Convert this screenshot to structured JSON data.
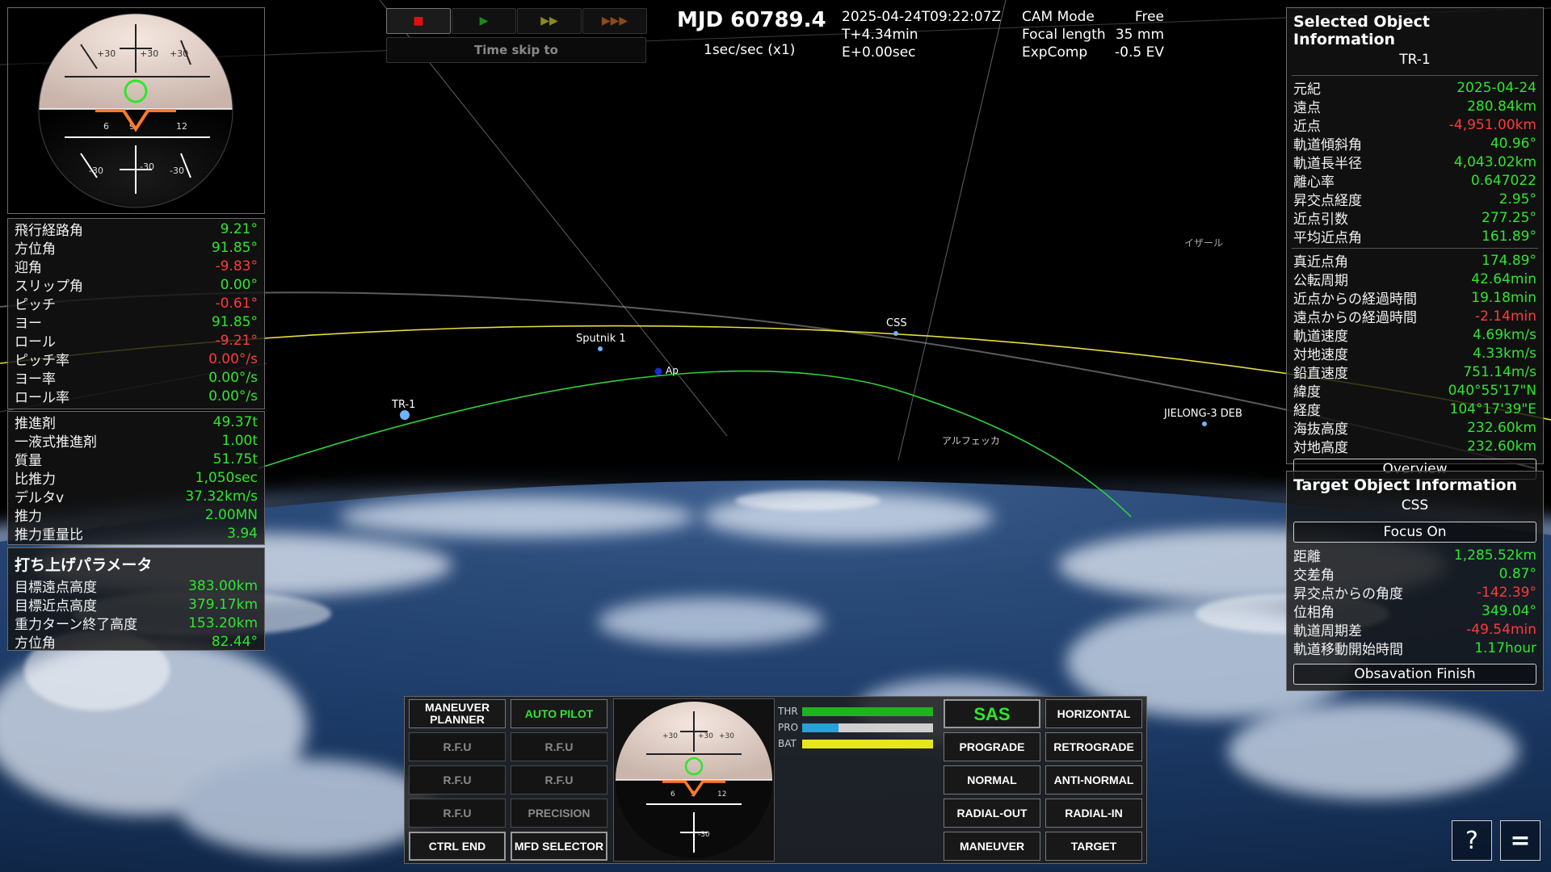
{
  "header": {
    "mjd": "MJD 60789.4",
    "rate": "1sec/sec (x1)",
    "utc": "2025-04-24T09:22:07Z",
    "t_plus": "T+4.34min",
    "e_plus": "E+0.00sec",
    "time_skip_label": "Time skip to",
    "cam_mode_label": "CAM Mode",
    "cam_mode_value": "Free",
    "focal_label": "Focal length",
    "focal_value": "35 mm",
    "exp_label": "ExpComp",
    "exp_value": "-0.5 EV"
  },
  "time_controls": [
    {
      "glyph": "■",
      "color": "#e01010",
      "active": true
    },
    {
      "glyph": "▶",
      "color": "#1c8a1c",
      "active": false
    },
    {
      "glyph": "▶▶",
      "color": "#8a8a1c",
      "active": false
    },
    {
      "glyph": "▶▶▶",
      "color": "#8a4a1c",
      "active": false
    }
  ],
  "flight": [
    {
      "k": "飛行経路角",
      "v": "9.21°",
      "s": "g"
    },
    {
      "k": "方位角",
      "v": "91.85°",
      "s": "g"
    },
    {
      "k": "迎角",
      "v": "-9.83°",
      "s": "r"
    },
    {
      "k": "スリップ角",
      "v": "0.00°",
      "s": "g"
    },
    {
      "k": "ピッチ",
      "v": "-0.61°",
      "s": "r"
    },
    {
      "k": "ヨー",
      "v": "91.85°",
      "s": "g"
    },
    {
      "k": "ロール",
      "v": "-9.21°",
      "s": "r"
    },
    {
      "k": "ピッチ率",
      "v": "0.00°/s",
      "s": "r"
    },
    {
      "k": "ヨー率",
      "v": "0.00°/s",
      "s": "g"
    },
    {
      "k": "ロール率",
      "v": "0.00°/s",
      "s": "g"
    }
  ],
  "propulsion": [
    {
      "k": "推進剤",
      "v": "49.37t",
      "s": "g"
    },
    {
      "k": "一液式推進剤",
      "v": "1.00t",
      "s": "g"
    },
    {
      "k": "質量",
      "v": "51.75t",
      "s": "g"
    },
    {
      "k": "比推力",
      "v": "1,050sec",
      "s": "g"
    },
    {
      "k": "デルタv",
      "v": "37.32km/s",
      "s": "g"
    },
    {
      "k": "推力",
      "v": "2.00MN",
      "s": "g"
    },
    {
      "k": "推力重量比",
      "v": "3.94",
      "s": "g"
    }
  ],
  "launch": {
    "title": "打ち上げパラメータ",
    "rows": [
      {
        "k": "目標遠点高度",
        "v": "383.00km",
        "s": "g"
      },
      {
        "k": "目標近点高度",
        "v": "379.17km",
        "s": "g"
      },
      {
        "k": "重力ターン終了高度",
        "v": "153.20km",
        "s": "g"
      },
      {
        "k": "方位角",
        "v": "82.44°",
        "s": "g"
      }
    ]
  },
  "selected": {
    "title": "Selected Object Information",
    "name": "TR-1",
    "rows1": [
      {
        "k": "元紀",
        "v": "2025-04-24",
        "s": "g"
      },
      {
        "k": "遠点",
        "v": "280.84km",
        "s": "g"
      },
      {
        "k": "近点",
        "v": "-4,951.00km",
        "s": "r"
      },
      {
        "k": "軌道傾斜角",
        "v": "40.96°",
        "s": "g"
      },
      {
        "k": "軌道長半径",
        "v": "4,043.02km",
        "s": "g"
      },
      {
        "k": "離心率",
        "v": "0.647022",
        "s": "g"
      },
      {
        "k": "昇交点経度",
        "v": "2.95°",
        "s": "g"
      },
      {
        "k": "近点引数",
        "v": "277.25°",
        "s": "g"
      },
      {
        "k": "平均近点角",
        "v": "161.89°",
        "s": "g"
      }
    ],
    "rows2": [
      {
        "k": "真近点角",
        "v": "174.89°",
        "s": "g"
      },
      {
        "k": "公転周期",
        "v": "42.64min",
        "s": "g"
      },
      {
        "k": "近点からの経過時間",
        "v": "19.18min",
        "s": "g"
      },
      {
        "k": "遠点からの経過時間",
        "v": "-2.14min",
        "s": "r"
      },
      {
        "k": "軌道速度",
        "v": "4.69km/s",
        "s": "g"
      },
      {
        "k": "対地速度",
        "v": "4.33km/s",
        "s": "g"
      },
      {
        "k": "鉛直速度",
        "v": "751.14m/s",
        "s": "g"
      },
      {
        "k": "緯度",
        "v": "040°55'17\"N",
        "s": "g"
      },
      {
        "k": "経度",
        "v": "104°17'39\"E",
        "s": "g"
      },
      {
        "k": "海抜高度",
        "v": "232.60km",
        "s": "g"
      },
      {
        "k": "対地高度",
        "v": "232.60km",
        "s": "g"
      }
    ],
    "button": "Overview"
  },
  "target": {
    "title": "Target Object Information",
    "name": "CSS",
    "focus_button": "Focus On",
    "rows": [
      {
        "k": "距離",
        "v": "1,285.52km",
        "s": "g"
      },
      {
        "k": "交差角",
        "v": "0.87°",
        "s": "g"
      },
      {
        "k": "昇交点からの角度",
        "v": "-142.39°",
        "s": "r"
      },
      {
        "k": "位相角",
        "v": "349.04°",
        "s": "g"
      },
      {
        "k": "軌道周期差",
        "v": "-49.54min",
        "s": "r"
      },
      {
        "k": "軌道移動開始時間",
        "v": "1.17hour",
        "s": "g"
      }
    ],
    "finish_button": "Obsavation Finish"
  },
  "scene_labels": {
    "sputnik": "Sputnik 1",
    "css": "CSS",
    "tr1": "TR-1",
    "ap": "Ap",
    "jielong": "JIELONG-3 DEB",
    "izar": "イザール",
    "alphecca": "アルフェッカ"
  },
  "left_buttons": [
    {
      "label": "MANEUVER PLANNER",
      "style": "normal"
    },
    {
      "label": "AUTO PILOT",
      "style": "green"
    },
    {
      "label": "R.F.U",
      "style": "dim"
    },
    {
      "label": "R.F.U",
      "style": "dim"
    },
    {
      "label": "R.F.U",
      "style": "dim"
    },
    {
      "label": "R.F.U",
      "style": "dim"
    },
    {
      "label": "R.F.U",
      "style": "dim"
    },
    {
      "label": "PRECISION",
      "style": "dim"
    },
    {
      "label": "CTRL END",
      "style": "active"
    },
    {
      "label": "MFD SELECTOR",
      "style": "active"
    }
  ],
  "bars": [
    {
      "label": "THR",
      "level": 1.0,
      "color": "#1fb41f"
    },
    {
      "label": "PRO",
      "level": 0.28,
      "color": "#2aa0d8"
    },
    {
      "label": "BAT",
      "level": 1.0,
      "color": "#e6e61a"
    }
  ],
  "right_buttons": [
    {
      "label": "SAS",
      "style": "sas"
    },
    {
      "label": "HORIZONTAL",
      "style": "normal"
    },
    {
      "label": "PROGRADE",
      "style": "normal"
    },
    {
      "label": "RETROGRADE",
      "style": "normal"
    },
    {
      "label": "NORMAL",
      "style": "normal"
    },
    {
      "label": "ANTI-NORMAL",
      "style": "normal"
    },
    {
      "label": "RADIAL-OUT",
      "style": "normal"
    },
    {
      "label": "RADIAL-IN",
      "style": "normal"
    },
    {
      "label": "MANEUVER",
      "style": "normal"
    },
    {
      "label": "TARGET",
      "style": "normal"
    }
  ],
  "corner": {
    "help": "?",
    "menu": "="
  },
  "colors": {
    "green": "#2ee62e",
    "red": "#ff3a3a",
    "orbit_green": "#2fd23a",
    "orbit_yellow": "#e6dc3c"
  }
}
